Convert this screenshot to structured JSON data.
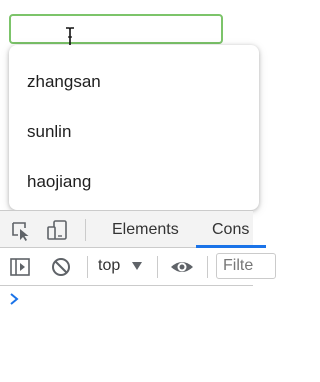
{
  "autocomplete": {
    "input_value": "",
    "options": [
      "zhangsan",
      "sunlin",
      "haojiang"
    ]
  },
  "devtools": {
    "tabs": [
      "Elements",
      "Cons"
    ],
    "active_tab": "Cons",
    "context_label": "top",
    "filter_placeholder": "Filte",
    "icons": [
      "inspect-element-icon",
      "device-toolbar-icon",
      "show-sidebar-icon",
      "clear-console-icon",
      "chevron-down-icon",
      "eye-icon",
      "console-prompt-icon"
    ]
  },
  "colors": {
    "input_border": "#7cc46a",
    "active_tab_underline": "#1a73e8",
    "prompt": "#1a73e8"
  }
}
